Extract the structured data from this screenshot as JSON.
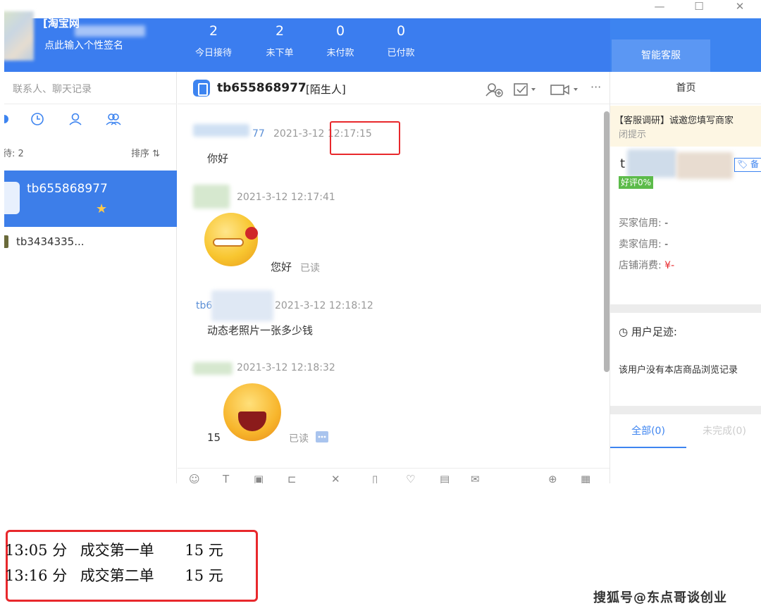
{
  "window": {
    "controls": [
      "—",
      "☐",
      "✕"
    ]
  },
  "header": {
    "shop_name": "[淘宝网",
    "signature": "点此输入个性签名",
    "stats": [
      {
        "num": "2",
        "label": "今日接待"
      },
      {
        "num": "2",
        "label": "未下单"
      },
      {
        "num": "0",
        "label": "未付款"
      },
      {
        "num": "0",
        "label": "已付款"
      }
    ],
    "smart_tab": "智能客服"
  },
  "left": {
    "search_placeholder": "联系人、聊天记录",
    "count_label": "待: 2",
    "sort_label": "排序 ⇅",
    "contacts": [
      {
        "name": "tb655868977"
      },
      {
        "name": "tb3434335..."
      }
    ]
  },
  "chat": {
    "user": "tb655868977",
    "user_tag": "[陌生人]",
    "messages": [
      {
        "sender_suffix": "77",
        "time": "2021-3-12 12:17:15",
        "text": "你好"
      },
      {
        "time": "2021-3-12 12:17:41",
        "text": "您好",
        "read": "已读"
      },
      {
        "sender_prefix": "tb6",
        "time": "2021-3-12 12:18:12",
        "text": "动态老照片一张多少钱"
      },
      {
        "time": "2021-3-12 12:18:32",
        "text": "15",
        "read": "已读"
      }
    ]
  },
  "right": {
    "home_tab": "首页",
    "notice_line1": "【客服调研】诚邀您填写商家",
    "notice_line2": "闭提示",
    "user_initial": "t",
    "tag_label": "🏷 备",
    "good_rate": "好评0%",
    "buyer_credit_label": "买家信用:",
    "buyer_credit_value": "-",
    "seller_credit_label": "卖家信用:",
    "seller_credit_value": "-",
    "shop_spend_label": "店铺消费:",
    "shop_spend_value": "¥-",
    "footprint_title": "用户足迹:",
    "footprint_text": "该用户没有本店商品浏览记录",
    "tab_all": "全部(0)",
    "tab_unfinished": "未完成(0)"
  },
  "orders": [
    {
      "time": "13:05 分",
      "desc": "成交第一单",
      "amount": "15 元"
    },
    {
      "time": "13:16 分",
      "desc": "成交第二单",
      "amount": "15 元"
    }
  ],
  "watermark": "搜狐号@东点哥谈创业",
  "colors": {
    "accent": "#3d84f0",
    "highlight_red": "#e8282c"
  }
}
